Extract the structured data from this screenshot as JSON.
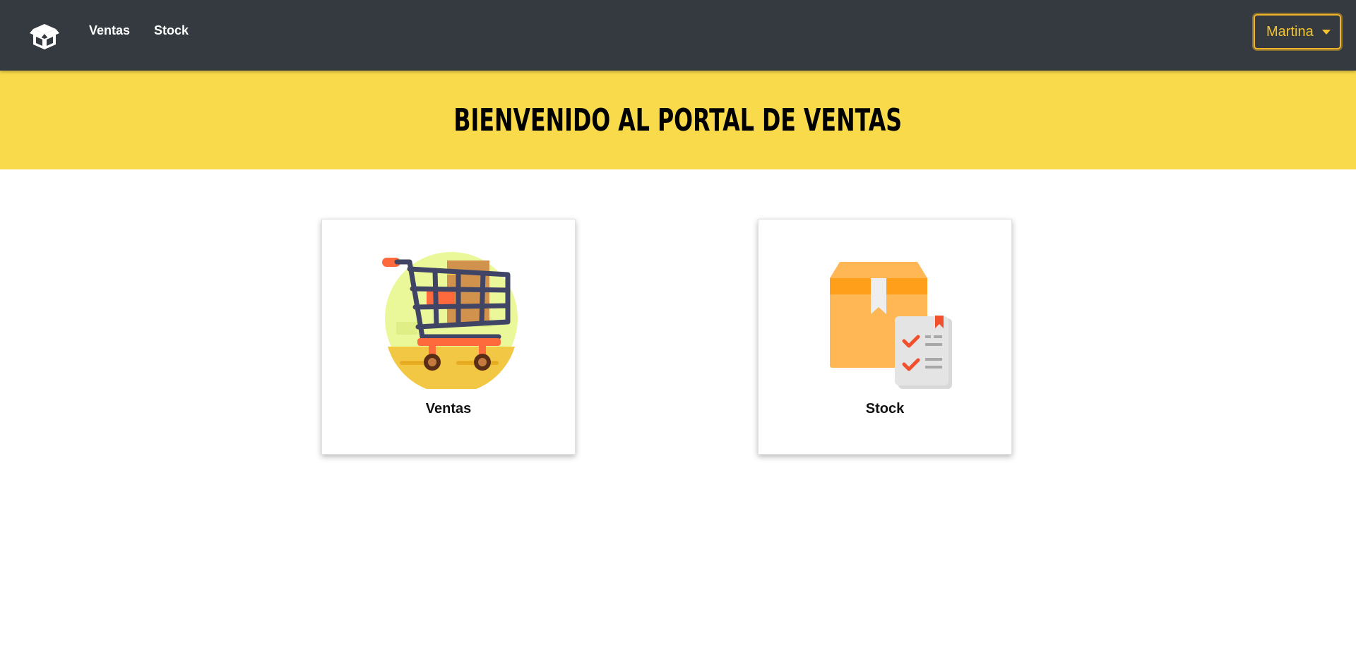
{
  "navbar": {
    "brand_icon": "open-box-logo-icon",
    "links": [
      {
        "label": "Ventas"
      },
      {
        "label": "Stock"
      }
    ],
    "user": {
      "label": "Martina",
      "icon": "chevron-down-icon"
    }
  },
  "hero": {
    "title": "BIENVENIDO AL PORTAL DE VENTAS"
  },
  "cards": [
    {
      "label": "Ventas",
      "icon": "shopping-cart-icon"
    },
    {
      "label": "Stock",
      "icon": "box-checklist-icon"
    }
  ],
  "colors": {
    "navbar": "#343a40",
    "hero": "#f8da4a",
    "accent": "#f4c430"
  }
}
